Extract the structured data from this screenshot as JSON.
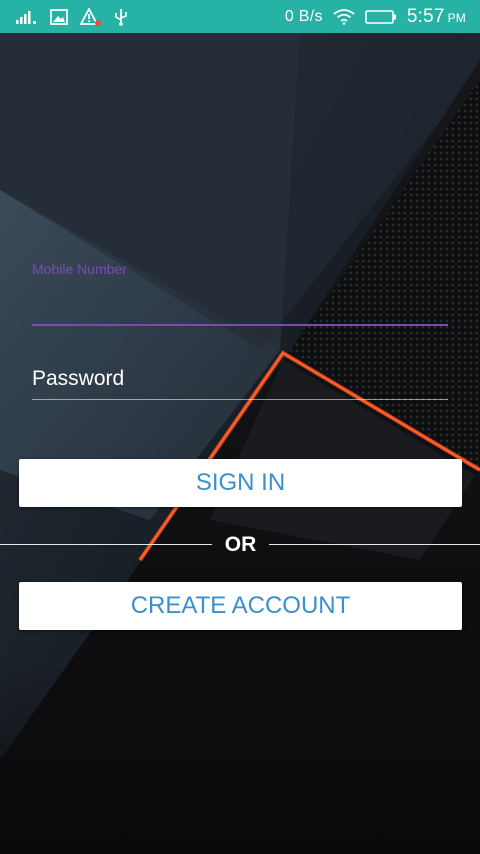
{
  "status_bar": {
    "net_speed": "0 B/s",
    "time": "5:57",
    "ampm": "PM",
    "icons": [
      "signal-icon",
      "image-notification-icon",
      "warning-icon",
      "usb-icon",
      "wifi-icon",
      "battery-icon"
    ],
    "background_color": "#26b3a6"
  },
  "login_form": {
    "mobile_label": "Mobile Number",
    "mobile_value": "",
    "password_placeholder": "Password",
    "accent_color": "#7b4bb5"
  },
  "actions": {
    "sign_in_label": "SIGN IN",
    "divider_text": "OR",
    "create_account_label": "CREATE ACCOUNT",
    "button_text_color": "#3a8fcc"
  }
}
